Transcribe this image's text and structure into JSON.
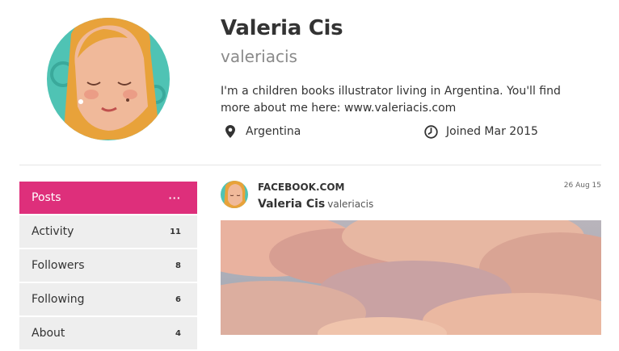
{
  "profile": {
    "name": "Valeria Cis",
    "handle": "valeriacis",
    "bio": "I'm a children books illustrator living in Argentina. You'll find more about me here: www.valeriacis.com",
    "location": "Argentina",
    "joined": "Joined Mar 2015",
    "avatar_icon": "illustrated-portrait"
  },
  "sidebar": {
    "items": [
      {
        "label": "Posts",
        "count": "···"
      },
      {
        "label": "Activity",
        "count": "11"
      },
      {
        "label": "Followers",
        "count": "8"
      },
      {
        "label": "Following",
        "count": "6"
      },
      {
        "label": "About",
        "count": "4"
      }
    ]
  },
  "post": {
    "source": "FACEBOOK.COM",
    "date": "26 Aug 15",
    "author_name": "Valeria Cis",
    "author_handle": "valeriacis"
  },
  "colors": {
    "accent": "#de2f7b",
    "nav_bg": "#eeeeee"
  }
}
